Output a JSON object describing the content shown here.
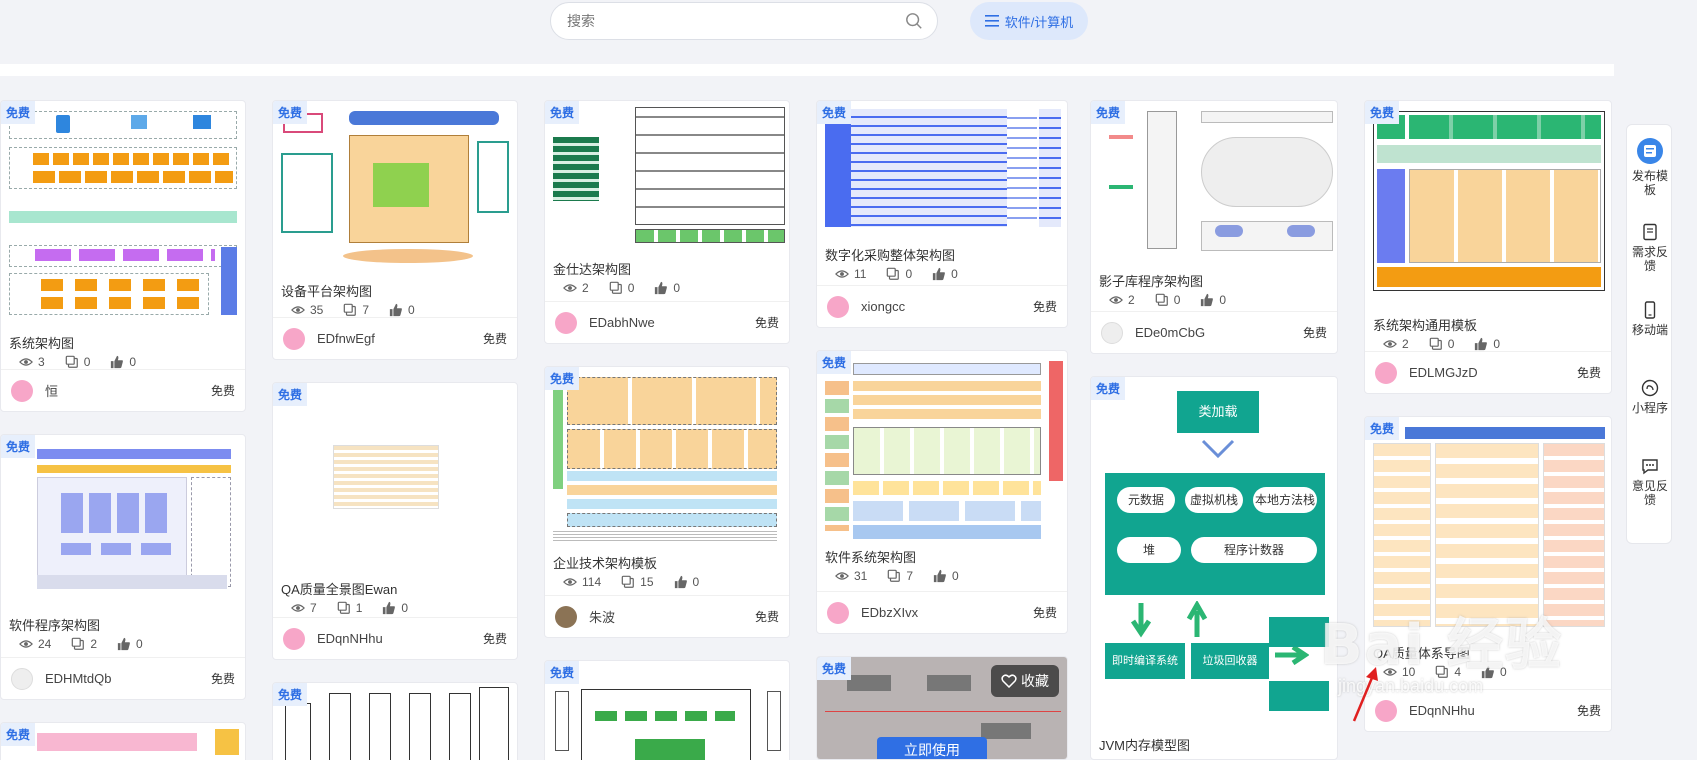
{
  "search": {
    "placeholder": "搜索"
  },
  "category_button": {
    "label": "软件/计算机"
  },
  "badge_free": "免费",
  "cards": [
    {
      "title": "系统架构图",
      "views": "3",
      "copies": "0",
      "likes": "0",
      "author": "恒",
      "price": "免费"
    },
    {
      "title": "设备平台架构图",
      "views": "35",
      "copies": "7",
      "likes": "0",
      "author": "EDfnwEgf",
      "price": "免费"
    },
    {
      "title": "金仕达架构图",
      "views": "2",
      "copies": "0",
      "likes": "0",
      "author": "EDabhNwe",
      "price": "免费"
    },
    {
      "title": "数字化采购整体架构图",
      "views": "11",
      "copies": "0",
      "likes": "0",
      "author": "xiongcc",
      "price": "免费"
    },
    {
      "title": "影子库程序架构图",
      "views": "2",
      "copies": "0",
      "likes": "0",
      "author": "EDe0mCbG",
      "price": "免费"
    },
    {
      "title": "系统架构通用模板",
      "views": "2",
      "copies": "0",
      "likes": "0",
      "author": "EDLMGJzD",
      "price": "免费"
    },
    {
      "title": "软件程序架构图",
      "views": "24",
      "copies": "2",
      "likes": "0",
      "author": "EDHMtdQb",
      "price": "免费"
    },
    {
      "title": "QA质量全景图Ewan",
      "views": "7",
      "copies": "1",
      "likes": "0",
      "author": "EDqnNHhu",
      "price": "免费"
    },
    {
      "title": "企业技术架构模板",
      "views": "114",
      "copies": "15",
      "likes": "0",
      "author": "朱波",
      "price": "免费"
    },
    {
      "title": "软件系统架构图",
      "views": "31",
      "copies": "7",
      "likes": "0",
      "author": "EDbzXIvx",
      "price": "免费"
    },
    {
      "title": "JVM内存模型图",
      "views": "",
      "copies": "",
      "likes": "",
      "author": "",
      "price": ""
    },
    {
      "title": "QA质量体系导图",
      "views": "10",
      "copies": "4",
      "likes": "0",
      "author": "EDqnNHhu",
      "price": "免费"
    }
  ],
  "jvm_labels": {
    "top": "类加载",
    "a": "元数据",
    "b": "虚拟机栈",
    "c": "本地方法栈",
    "d": "堆",
    "e": "程序计数器",
    "f": "即时编译系统",
    "g": "垃圾回收器"
  },
  "hover": {
    "favorite": "收藏",
    "use": "立即使用"
  },
  "sidebar": [
    {
      "label": "发布模板"
    },
    {
      "label": "需求反馈"
    },
    {
      "label": "移动端"
    },
    {
      "label": "小程序"
    },
    {
      "label": "意见反馈"
    }
  ],
  "watermark": {
    "text": "Bai 经验",
    "url": "jingyan.baidu.com"
  },
  "colors": {
    "accent": "#2f6fe4",
    "badge_bg": "#e7effc",
    "jvm_green": "#11a590"
  }
}
